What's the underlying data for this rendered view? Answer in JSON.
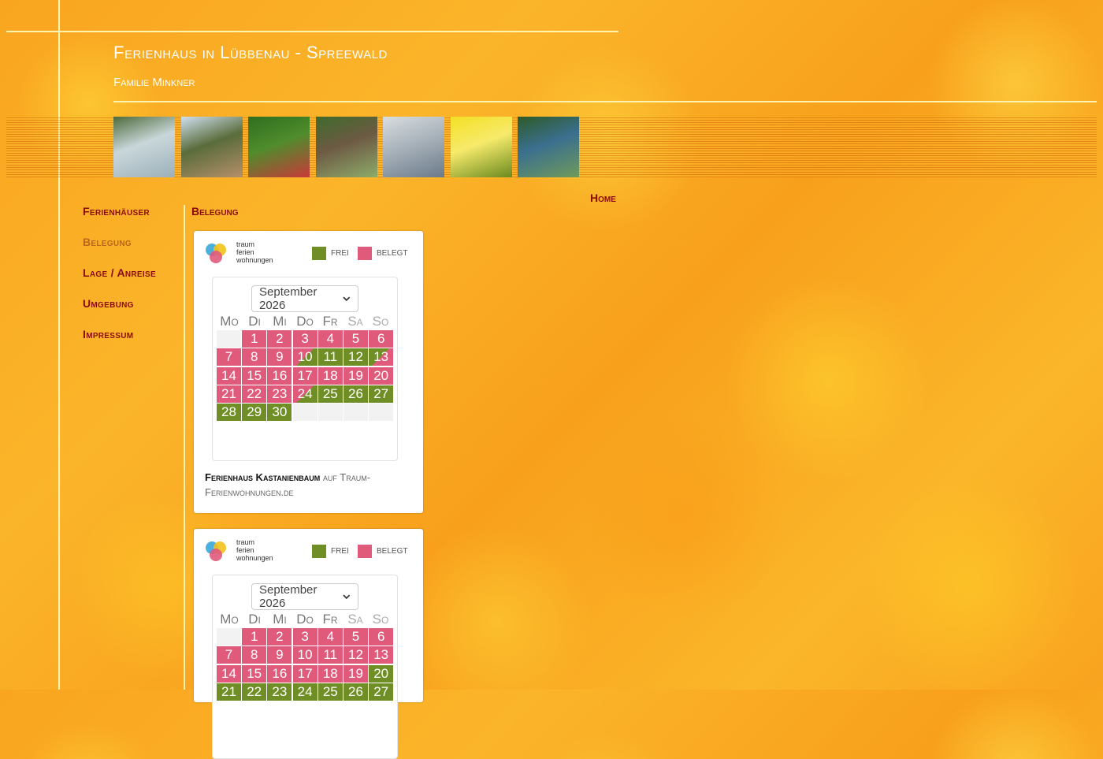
{
  "header": {
    "title": "Ferienhaus in Lübbenau - Spreewald",
    "subtitle": "Familie Minkner"
  },
  "photos": [
    {
      "name": "photo-footbridge",
      "colors": [
        "#4e6b3a",
        "#9bb0b9",
        "#c9d7da"
      ]
    },
    {
      "name": "photo-church",
      "colors": [
        "#cfe0ef",
        "#b58f6b",
        "#5a6c3b"
      ]
    },
    {
      "name": "photo-water-lily",
      "colors": [
        "#2f6e1f",
        "#c83a3a",
        "#4f8c2c"
      ]
    },
    {
      "name": "photo-forest-bridge",
      "colors": [
        "#3e6b2a",
        "#8eab6a",
        "#6d5a44"
      ]
    },
    {
      "name": "photo-birch-forest",
      "colors": [
        "#d9dde0",
        "#6b7a8a",
        "#a9b3bb"
      ]
    },
    {
      "name": "photo-sunflower",
      "colors": [
        "#f4df24",
        "#6a8a1e",
        "#f7ea6b"
      ]
    },
    {
      "name": "photo-canoe",
      "colors": [
        "#2e5a26",
        "#6f9a5a",
        "#3a6f8f"
      ]
    }
  ],
  "top_link": {
    "label": "Home"
  },
  "nav": [
    {
      "label": "Ferienhäuser",
      "active": false
    },
    {
      "label": "Belegung",
      "active": true
    },
    {
      "label": "Lage / Anreise",
      "active": false
    },
    {
      "label": "Umgebung",
      "active": false
    },
    {
      "label": "Impressum",
      "active": false
    }
  ],
  "content": {
    "section_title": "Belegung"
  },
  "colors": {
    "free": "#6f8f26",
    "booked": "#e05a7b",
    "empty": "#f2f2f2",
    "nav": "#8a0c0c",
    "nav_active": "#b9671a"
  },
  "widgets": [
    {
      "logo": {
        "line1": "traum",
        "line2": "ferien",
        "line3": "wohnungen"
      },
      "legend": {
        "free_label": "FREI",
        "booked_label": "BELEGT"
      },
      "month_select": {
        "value": "September 2026"
      },
      "weekdays": [
        "Mo",
        "Di",
        "Mi",
        "Do",
        "Fr",
        "Sa",
        "So"
      ],
      "days": [
        {
          "day": "",
          "status": "empty"
        },
        {
          "day": "1",
          "status": "booked"
        },
        {
          "day": "2",
          "status": "booked"
        },
        {
          "day": "3",
          "status": "booked"
        },
        {
          "day": "4",
          "status": "booked"
        },
        {
          "day": "5",
          "status": "booked"
        },
        {
          "day": "6",
          "status": "booked"
        },
        {
          "day": "7",
          "status": "booked"
        },
        {
          "day": "8",
          "status": "booked"
        },
        {
          "day": "9",
          "status": "booked"
        },
        {
          "day": "10",
          "status": "change-to-free"
        },
        {
          "day": "11",
          "status": "free"
        },
        {
          "day": "12",
          "status": "free"
        },
        {
          "day": "13",
          "status": "change-to-booked"
        },
        {
          "day": "14",
          "status": "booked"
        },
        {
          "day": "15",
          "status": "booked"
        },
        {
          "day": "16",
          "status": "booked"
        },
        {
          "day": "17",
          "status": "booked"
        },
        {
          "day": "18",
          "status": "booked"
        },
        {
          "day": "19",
          "status": "booked"
        },
        {
          "day": "20",
          "status": "booked"
        },
        {
          "day": "21",
          "status": "booked"
        },
        {
          "day": "22",
          "status": "booked"
        },
        {
          "day": "23",
          "status": "booked"
        },
        {
          "day": "24",
          "status": "change-to-free"
        },
        {
          "day": "25",
          "status": "free"
        },
        {
          "day": "26",
          "status": "free"
        },
        {
          "day": "27",
          "status": "free"
        },
        {
          "day": "28",
          "status": "free"
        },
        {
          "day": "29",
          "status": "free"
        },
        {
          "day": "30",
          "status": "free"
        },
        {
          "day": "",
          "status": "empty"
        },
        {
          "day": "",
          "status": "empty"
        },
        {
          "day": "",
          "status": "empty"
        },
        {
          "day": "",
          "status": "empty"
        }
      ],
      "footer": {
        "name": "Ferienhaus Kastanienbaum",
        "suffix": " auf Traum-Ferienwohnungen.de"
      }
    },
    {
      "logo": {
        "line1": "traum",
        "line2": "ferien",
        "line3": "wohnungen"
      },
      "legend": {
        "free_label": "FREI",
        "booked_label": "BELEGT"
      },
      "month_select": {
        "value": "September 2026"
      },
      "weekdays": [
        "Mo",
        "Di",
        "Mi",
        "Do",
        "Fr",
        "Sa",
        "So"
      ],
      "days": [
        {
          "day": "",
          "status": "empty"
        },
        {
          "day": "1",
          "status": "booked"
        },
        {
          "day": "2",
          "status": "booked"
        },
        {
          "day": "3",
          "status": "booked"
        },
        {
          "day": "4",
          "status": "booked"
        },
        {
          "day": "5",
          "status": "booked"
        },
        {
          "day": "6",
          "status": "booked"
        },
        {
          "day": "7",
          "status": "booked"
        },
        {
          "day": "8",
          "status": "booked"
        },
        {
          "day": "9",
          "status": "booked"
        },
        {
          "day": "10",
          "status": "booked"
        },
        {
          "day": "11",
          "status": "booked"
        },
        {
          "day": "12",
          "status": "booked"
        },
        {
          "day": "13",
          "status": "booked"
        },
        {
          "day": "14",
          "status": "booked"
        },
        {
          "day": "15",
          "status": "booked"
        },
        {
          "day": "16",
          "status": "booked"
        },
        {
          "day": "17",
          "status": "booked"
        },
        {
          "day": "18",
          "status": "booked"
        },
        {
          "day": "19",
          "status": "booked"
        },
        {
          "day": "20",
          "status": "free"
        },
        {
          "day": "21",
          "status": "free"
        },
        {
          "day": "22",
          "status": "free"
        },
        {
          "day": "23",
          "status": "free"
        },
        {
          "day": "24",
          "status": "free"
        },
        {
          "day": "25",
          "status": "free"
        },
        {
          "day": "26",
          "status": "free"
        },
        {
          "day": "27",
          "status": "free"
        }
      ],
      "footer": {
        "name": "",
        "suffix": ""
      }
    }
  ]
}
